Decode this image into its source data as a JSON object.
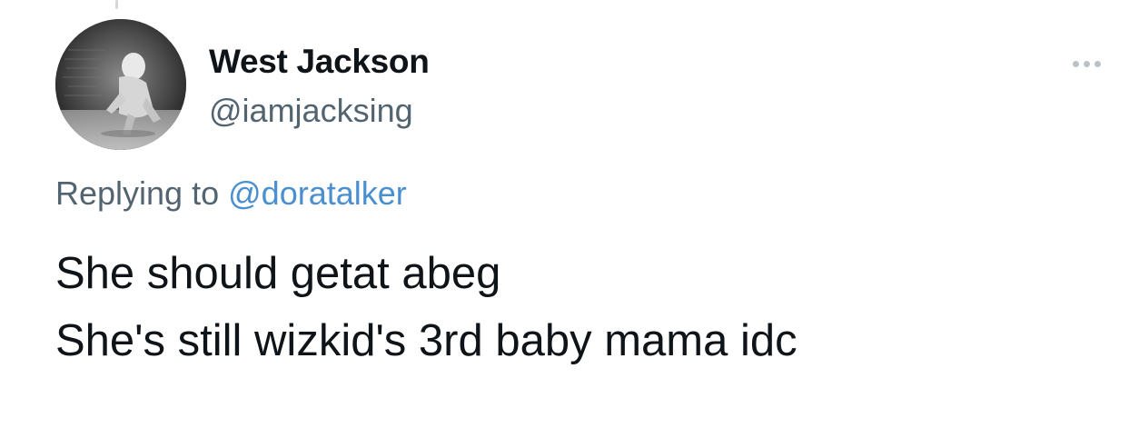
{
  "author": {
    "display_name": "West Jackson",
    "handle": "@iamjacksing",
    "avatar_icon": "user-avatar-photo"
  },
  "reply": {
    "prefix": "Replying to",
    "mention": "@doratalker"
  },
  "tweet": {
    "lines": [
      "She should getat abeg",
      "She's still wizkid's 3rd baby mama idc"
    ]
  },
  "icons": {
    "more": "more-horizontal-icon"
  },
  "colors": {
    "text": "#0f1419",
    "secondary_text": "#536471",
    "mention": "#4a8fcf",
    "background": "#ffffff"
  }
}
